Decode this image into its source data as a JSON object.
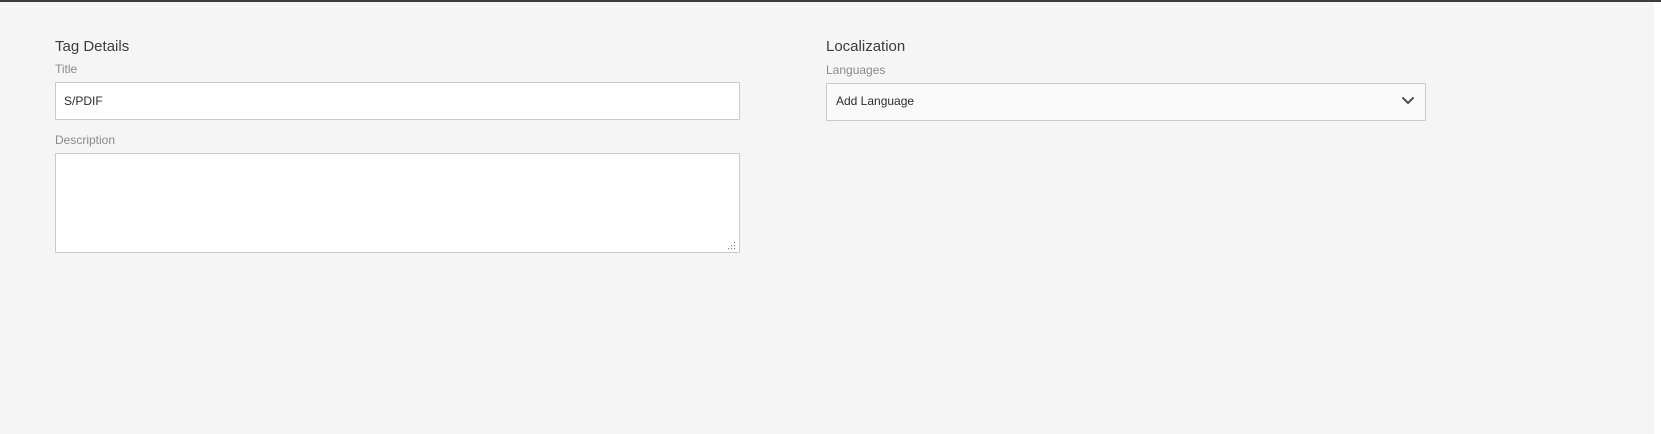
{
  "tag_details": {
    "heading": "Tag Details",
    "title_label": "Title",
    "title_value": "S/PDIF",
    "description_label": "Description",
    "description_value": ""
  },
  "localization": {
    "heading": "Localization",
    "languages_label": "Languages",
    "languages_select_value": "Add Language",
    "chevron_icon": "chevron-down-icon",
    "resize_icon": "resize-grip-icon"
  }
}
